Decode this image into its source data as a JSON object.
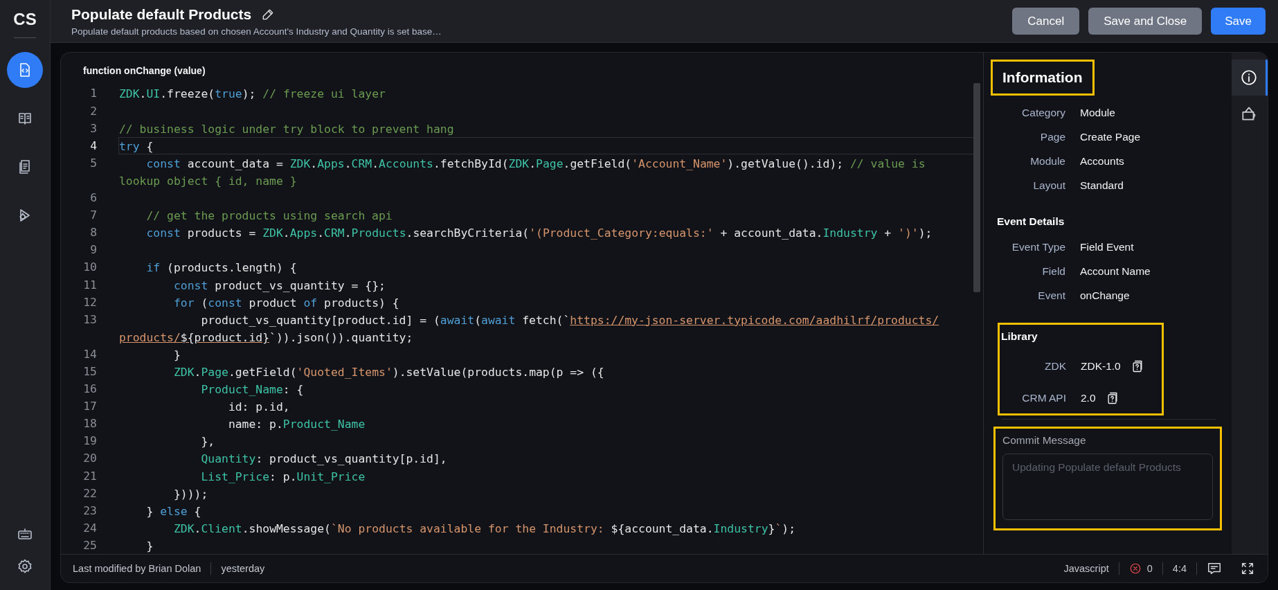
{
  "sidebar": {
    "logo": "CS",
    "items": [
      {
        "selected": true
      },
      {
        "selected": false
      },
      {
        "selected": false
      },
      {
        "selected": false
      }
    ],
    "bottom_items": [
      {
        "selected": false
      },
      {
        "selected": false
      }
    ]
  },
  "header": {
    "title": "Populate default Products",
    "subtitle": "Populate default products based on chosen Account's Industry and Quantity is set base…",
    "buttons": [
      {
        "label": "Cancel",
        "kind": "secondary"
      },
      {
        "label": "Save and Close",
        "kind": "secondary"
      },
      {
        "label": "Save",
        "kind": "primary"
      }
    ]
  },
  "editor": {
    "signature": "function onChange (value)",
    "lines": [
      {
        "number": "1",
        "current": false,
        "tokens": [
          {
            "kind": "member",
            "text": "ZDK"
          },
          {
            "kind": "plain",
            "text": "."
          },
          {
            "kind": "member",
            "text": "UI"
          },
          {
            "kind": "plain",
            "text": ".freeze("
          },
          {
            "kind": "keyword",
            "text": "true"
          },
          {
            "kind": "plain",
            "text": "); "
          },
          {
            "kind": "comment",
            "text": "// freeze ui layer"
          }
        ]
      },
      {
        "number": "2",
        "current": false
      },
      {
        "number": "3",
        "current": false,
        "tokens": [
          {
            "kind": "comment",
            "text": "// business logic under try block to prevent hang"
          }
        ]
      },
      {
        "number": "4",
        "current": true,
        "tokens": [
          {
            "kind": "keyword",
            "text": "try"
          },
          {
            "kind": "plain",
            "text": " {"
          }
        ]
      },
      {
        "number": "5",
        "current": false,
        "tokens": [
          {
            "kind": "keyword",
            "text": "    const"
          },
          {
            "kind": "plain",
            "text": " account_data = "
          },
          {
            "kind": "member",
            "text": "ZDK"
          },
          {
            "kind": "plain",
            "text": "."
          },
          {
            "kind": "member",
            "text": "Apps"
          },
          {
            "kind": "plain",
            "text": "."
          },
          {
            "kind": "member",
            "text": "CRM"
          },
          {
            "kind": "plain",
            "text": "."
          },
          {
            "kind": "member",
            "text": "Accounts"
          },
          {
            "kind": "plain",
            "text": ".fetchById("
          },
          {
            "kind": "member",
            "text": "ZDK"
          },
          {
            "kind": "plain",
            "text": "."
          },
          {
            "kind": "member",
            "text": "Page"
          },
          {
            "kind": "plain",
            "text": ".getField("
          },
          {
            "kind": "string",
            "text": "'Account_Name'"
          },
          {
            "kind": "plain",
            "text": ").getValue().id); "
          },
          {
            "kind": "comment",
            "text": "// value is"
          }
        ],
        "continuation": [
          {
            "kind": "comment",
            "text": "lookup object { id, name }"
          }
        ]
      },
      {
        "number": "6",
        "current": false
      },
      {
        "number": "7",
        "current": false,
        "tokens": [
          {
            "kind": "comment",
            "text": "    // get the products using search api"
          }
        ]
      },
      {
        "number": "8",
        "current": false,
        "tokens": [
          {
            "kind": "keyword",
            "text": "    const"
          },
          {
            "kind": "plain",
            "text": " products = "
          },
          {
            "kind": "member",
            "text": "ZDK"
          },
          {
            "kind": "plain",
            "text": "."
          },
          {
            "kind": "member",
            "text": "Apps"
          },
          {
            "kind": "plain",
            "text": "."
          },
          {
            "kind": "member",
            "text": "CRM"
          },
          {
            "kind": "plain",
            "text": "."
          },
          {
            "kind": "member",
            "text": "Products"
          },
          {
            "kind": "plain",
            "text": ".searchByCriteria("
          },
          {
            "kind": "string",
            "text": "'(Product_Category:equals:'"
          },
          {
            "kind": "plain",
            "text": " + account_data."
          },
          {
            "kind": "member",
            "text": "Industry"
          },
          {
            "kind": "plain",
            "text": " + "
          },
          {
            "kind": "string",
            "text": "')'"
          },
          {
            "kind": "plain",
            "text": ");"
          }
        ]
      },
      {
        "number": "9",
        "current": false
      },
      {
        "number": "10",
        "current": false,
        "tokens": [
          {
            "kind": "keyword",
            "text": "    if"
          },
          {
            "kind": "plain",
            "text": " (products.length) {"
          }
        ]
      },
      {
        "number": "11",
        "current": false,
        "tokens": [
          {
            "kind": "keyword",
            "text": "        const"
          },
          {
            "kind": "plain",
            "text": " product_vs_quantity = {};"
          }
        ]
      },
      {
        "number": "12",
        "current": false,
        "tokens": [
          {
            "kind": "keyword",
            "text": "        for"
          },
          {
            "kind": "plain",
            "text": " ("
          },
          {
            "kind": "keyword",
            "text": "const"
          },
          {
            "kind": "plain",
            "text": " product "
          },
          {
            "kind": "keyword",
            "text": "of"
          },
          {
            "kind": "plain",
            "text": " products) {"
          }
        ]
      },
      {
        "number": "13",
        "current": false,
        "tokens": [
          {
            "kind": "plain",
            "text": "            product_vs_quantity[product.id] = ("
          },
          {
            "kind": "keyword",
            "text": "await"
          },
          {
            "kind": "plain",
            "text": "("
          },
          {
            "kind": "keyword",
            "text": "await"
          },
          {
            "kind": "plain",
            "text": " fetch(`"
          },
          {
            "kind": "url",
            "text": "https://my-json-server.typicode.com/aadhilrf/products/"
          }
        ],
        "continuation": [
          {
            "kind": "url",
            "text": "products/"
          },
          {
            "kind": "url-expr",
            "text": "${product.id}"
          },
          {
            "kind": "plain",
            "text": "`)).json()).quantity;"
          }
        ]
      },
      {
        "number": "14",
        "current": false,
        "tokens": [
          {
            "kind": "plain",
            "text": "        }"
          }
        ]
      },
      {
        "number": "15",
        "current": false,
        "tokens": [
          {
            "kind": "member",
            "text": "        ZDK"
          },
          {
            "kind": "plain",
            "text": "."
          },
          {
            "kind": "member",
            "text": "Page"
          },
          {
            "kind": "plain",
            "text": ".getField("
          },
          {
            "kind": "string",
            "text": "'Quoted_Items'"
          },
          {
            "kind": "plain",
            "text": ").setValue(products.map(p => ({"
          }
        ]
      },
      {
        "number": "16",
        "current": false,
        "tokens": [
          {
            "kind": "member",
            "text": "            Product_Name"
          },
          {
            "kind": "plain",
            "text": ": {"
          }
        ]
      },
      {
        "number": "17",
        "current": false,
        "tokens": [
          {
            "kind": "plain",
            "text": "                id: p.id,"
          }
        ]
      },
      {
        "number": "18",
        "current": false,
        "tokens": [
          {
            "kind": "plain",
            "text": "                name: p."
          },
          {
            "kind": "member",
            "text": "Product_Name"
          }
        ]
      },
      {
        "number": "19",
        "current": false,
        "tokens": [
          {
            "kind": "plain",
            "text": "            },"
          }
        ]
      },
      {
        "number": "20",
        "current": false,
        "tokens": [
          {
            "kind": "member",
            "text": "            Quantity"
          },
          {
            "kind": "plain",
            "text": ": product_vs_quantity[p.id],"
          }
        ]
      },
      {
        "number": "21",
        "current": false,
        "tokens": [
          {
            "kind": "member",
            "text": "            List_Price"
          },
          {
            "kind": "plain",
            "text": ": p."
          },
          {
            "kind": "member",
            "text": "Unit_Price"
          }
        ]
      },
      {
        "number": "22",
        "current": false,
        "tokens": [
          {
            "kind": "plain",
            "text": "        })));"
          }
        ]
      },
      {
        "number": "23",
        "current": false,
        "tokens": [
          {
            "kind": "plain",
            "text": "    } "
          },
          {
            "kind": "keyword",
            "text": "else"
          },
          {
            "kind": "plain",
            "text": " {"
          }
        ]
      },
      {
        "number": "24",
        "current": false,
        "tokens": [
          {
            "kind": "member",
            "text": "        ZDK"
          },
          {
            "kind": "plain",
            "text": "."
          },
          {
            "kind": "member",
            "text": "Client"
          },
          {
            "kind": "plain",
            "text": ".showMessage("
          },
          {
            "kind": "string",
            "text": "`No products available for the Industry: "
          },
          {
            "kind": "plain",
            "text": "${account_data."
          },
          {
            "kind": "member",
            "text": "Industry"
          },
          {
            "kind": "plain",
            "text": "}"
          },
          {
            "kind": "string",
            "text": "`"
          },
          {
            "kind": "plain",
            "text": ");"
          }
        ]
      },
      {
        "number": "25",
        "current": false,
        "tokens": [
          {
            "kind": "plain",
            "text": "    }"
          }
        ]
      }
    ]
  },
  "info_panel": {
    "title": "Information",
    "title_highlighted": true,
    "fields": [
      {
        "label": "Category",
        "value": "Module"
      },
      {
        "label": "Page",
        "value": "Create Page"
      },
      {
        "label": "Module",
        "value": "Accounts"
      },
      {
        "label": "Layout",
        "value": "Standard"
      }
    ],
    "event_details": {
      "title": "Event Details",
      "fields": [
        {
          "label": "Event Type",
          "value": "Field Event"
        },
        {
          "label": "Field",
          "value": "Account Name"
        },
        {
          "label": "Event",
          "value": "onChange"
        }
      ]
    },
    "library": {
      "title": "Library",
      "highlighted": true,
      "items": [
        {
          "label": "ZDK",
          "value": "ZDK-1.0"
        },
        {
          "label": "CRM API",
          "value": "2.0"
        }
      ]
    },
    "commit": {
      "label": "Commit Message",
      "placeholder": "Updating Populate default Products",
      "highlighted": true
    }
  },
  "side_tabs": [
    {
      "selected": true
    },
    {
      "selected": false
    }
  ],
  "status_bar": {
    "modified_by": "Last modified by Brian Dolan",
    "modified_time": "yesterday",
    "language": "Javascript",
    "errors": "0",
    "cursor": "4:4"
  }
}
